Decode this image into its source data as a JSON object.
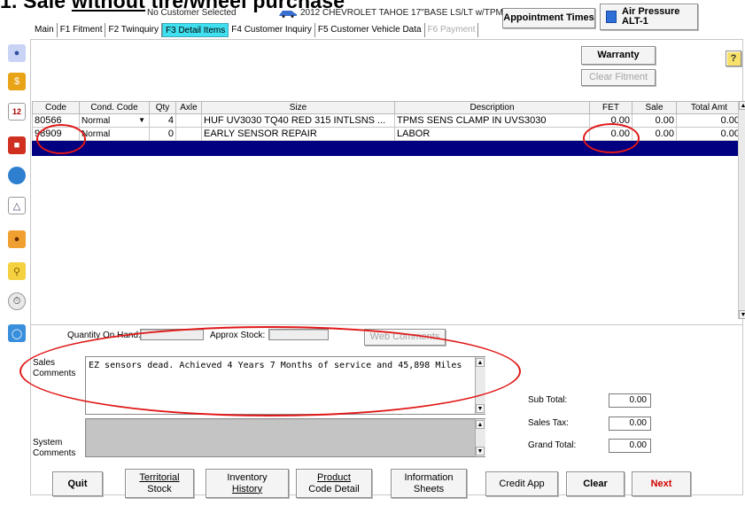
{
  "slide_title": {
    "prefix": "1. Sale ",
    "underlined": "without",
    "suffix": " tire/wheel purchase"
  },
  "header": {
    "customer": "No Customer Selected",
    "vehicle": "2012 CHEVROLET TAHOE 17\"BASE LS/LT w/TPMS",
    "appointment_label": "Appointment Times",
    "air_pressure_label": "Air Pressure",
    "air_pressure_value": "ALT-1"
  },
  "tabs": [
    "Main",
    "F1 Fitment",
    "F2 Twinquiry",
    "F3 Detail Items",
    "F4 Customer Inquiry",
    "F5 Customer Vehicle Data",
    "F6 Payment"
  ],
  "active_tab": "F3 Detail Items",
  "actions": {
    "warranty": "Warranty",
    "clear_fitment": "Clear Fitment",
    "help": "?"
  },
  "grid": {
    "columns": [
      "Code",
      "Cond. Code",
      "Qty",
      "Axle",
      "Size",
      "Description",
      "FET",
      "Sale",
      "Total Amt"
    ],
    "rows": [
      {
        "code": "80566",
        "cond": "Normal",
        "qty": "4",
        "axle": "",
        "size": "HUF UV3030 TQ40 RED 315 INTLSNS ...",
        "description": "TPMS SENS CLAMP IN UVS3030",
        "fet": "0.00",
        "sale": "0.00",
        "total": "0.00"
      },
      {
        "code": "98909",
        "cond": "Normal",
        "qty": "0",
        "axle": "",
        "size": "EARLY SENSOR REPAIR",
        "description": "LABOR",
        "fet": "0.00",
        "sale": "0.00",
        "total": "0.00"
      }
    ]
  },
  "stock": {
    "qoh_label": "Quantity On Hand:",
    "approx_label": "Approx Stock:",
    "web_comments": "Web Comments"
  },
  "comments": {
    "sales_label_1": "Sales",
    "sales_label_2": "Comments",
    "sales_text": "EZ sensors dead.  Achieved 4 Years 7 Months of service and 45,898 Miles",
    "system_label_1": "System",
    "system_label_2": "Comments"
  },
  "totals": {
    "subtotal_label": "Sub Total:",
    "subtotal": "0.00",
    "tax_label": "Sales Tax:",
    "tax": "0.00",
    "grand_label": "Grand Total:",
    "grand": "0.00"
  },
  "footer": {
    "quit": "Quit",
    "territorial_1": "Territorial",
    "territorial_2": "Stock",
    "inventory_1": "Inventory",
    "inventory_2": "History",
    "product_1": "Product",
    "product_2": "Code Detail",
    "info_1": "Information",
    "info_2": "Sheets",
    "credit": "Credit App",
    "clear": "Clear",
    "next": "Next"
  },
  "colors": {
    "active_tab": "#40e0f0",
    "selection": "#000080",
    "annotation": "#e01818",
    "next_text": "#d00000"
  }
}
